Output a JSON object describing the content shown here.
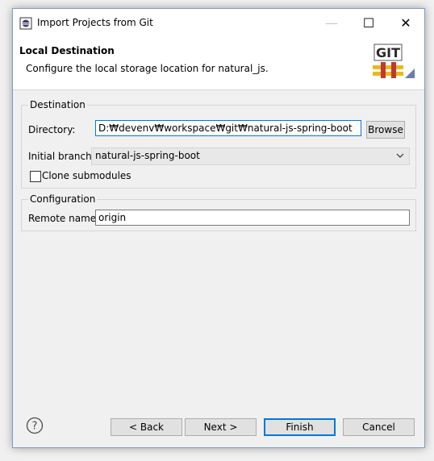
{
  "window": {
    "title": "Import Projects from Git",
    "minimize_symbol": "—",
    "maximize_symbol": "☐",
    "close_symbol": "✕"
  },
  "header": {
    "title": "Local Destination",
    "description": "Configure the local storage location for natural_js.",
    "logo_text": "GIT"
  },
  "destination": {
    "legend": "Destination",
    "directory_label": "Directory:",
    "directory_value": "D:₩devenv₩workspace₩git₩natural-js-spring-boot",
    "browse_label": "Browse",
    "initial_branch_label": "Initial branch:",
    "initial_branch_value": "natural-js-spring-boot",
    "clone_submodules_label": "Clone submodules",
    "clone_submodules_checked": false
  },
  "configuration": {
    "legend": "Configuration",
    "remote_name_label": "Remote name:",
    "remote_name_value": "origin"
  },
  "footer": {
    "help_symbol": "?",
    "back_label": "< Back",
    "next_label": "Next >",
    "finish_label": "Finish",
    "cancel_label": "Cancel"
  },
  "colors": {
    "accent": "#0078d7",
    "git_red": "#c0392b",
    "git_yellow": "#e8b923"
  }
}
